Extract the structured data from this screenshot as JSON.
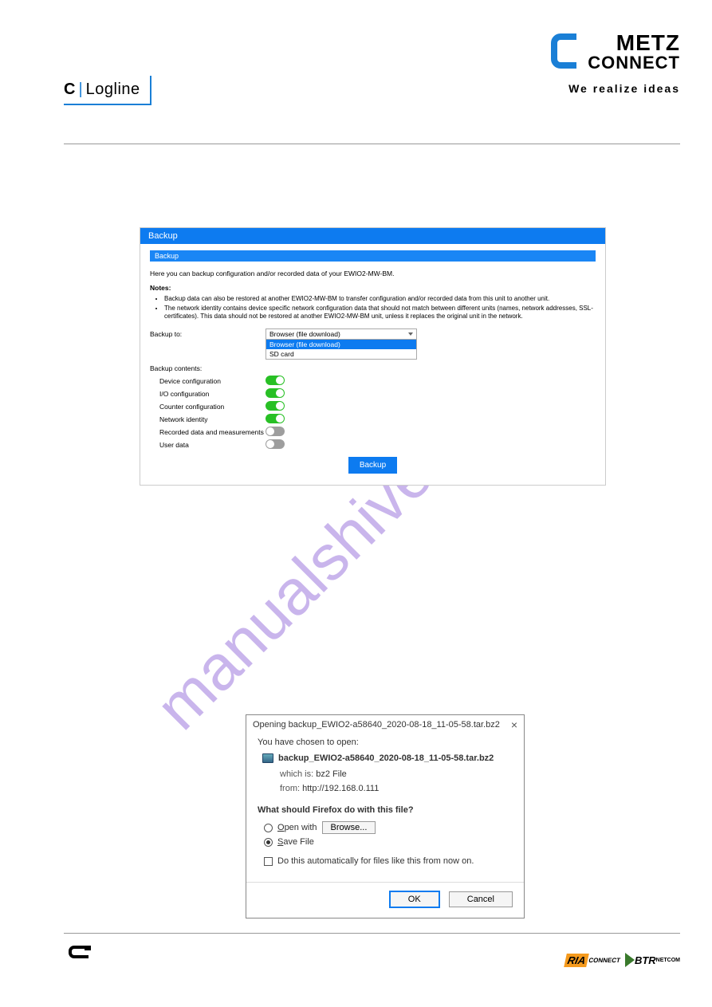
{
  "header": {
    "brand_line1": "METZ",
    "brand_line2": "CONNECT",
    "tagline": "We realize ideas",
    "logline_c": "C",
    "logline_text": "Logline"
  },
  "backup_panel": {
    "title": "Backup",
    "subhead": "Backup",
    "intro": "Here you can backup configuration and/or recorded data of your EWIO2-MW-BM.",
    "notes_label": "Notes:",
    "notes": [
      "Backup data can also be restored at another EWIO2-MW-BM to transfer configuration and/or recorded data from this unit to another unit.",
      "The network identity contains device specific network configuration data that should not match between different units (names, network addresses, SSL-certificates). This data should not be restored at another EWIO2-MW-BM unit, unless it replaces the original unit in the network."
    ],
    "backup_to_label": "Backup to:",
    "select_value": "Browser (file download)",
    "select_options": [
      "Browser (file download)",
      "SD card"
    ],
    "contents_label": "Backup contents:",
    "contents": [
      {
        "label": "Device configuration",
        "on": true
      },
      {
        "label": "I/O configuration",
        "on": true
      },
      {
        "label": "Counter configuration",
        "on": true
      },
      {
        "label": "Network identity",
        "on": true
      },
      {
        "label": "Recorded data and measurements",
        "on": false
      },
      {
        "label": "User data",
        "on": false
      }
    ],
    "button": "Backup"
  },
  "watermark": "manualshive.com",
  "dialog": {
    "title": "Opening backup_EWIO2-a58640_2020-08-18_11-05-58.tar.bz2",
    "chosen": "You have chosen to open:",
    "filename": "backup_EWIO2-a58640_2020-08-18_11-05-58.tar.bz2",
    "which_is_label": "which is:",
    "which_is_value": "bz2 File",
    "from_label": "from:",
    "from_value": "http://192.168.0.111",
    "question": "What should Firefox do with this file?",
    "open_with": "Open with",
    "browse": "Browse...",
    "save_file": "Save File",
    "auto": "Do this automatically for files like this from now on.",
    "ok": "OK",
    "cancel": "Cancel"
  },
  "footer": {
    "ria": "RIA",
    "ria_sub": "CONNECT",
    "btr": "BTR",
    "btr_sub": "NETCOM"
  }
}
